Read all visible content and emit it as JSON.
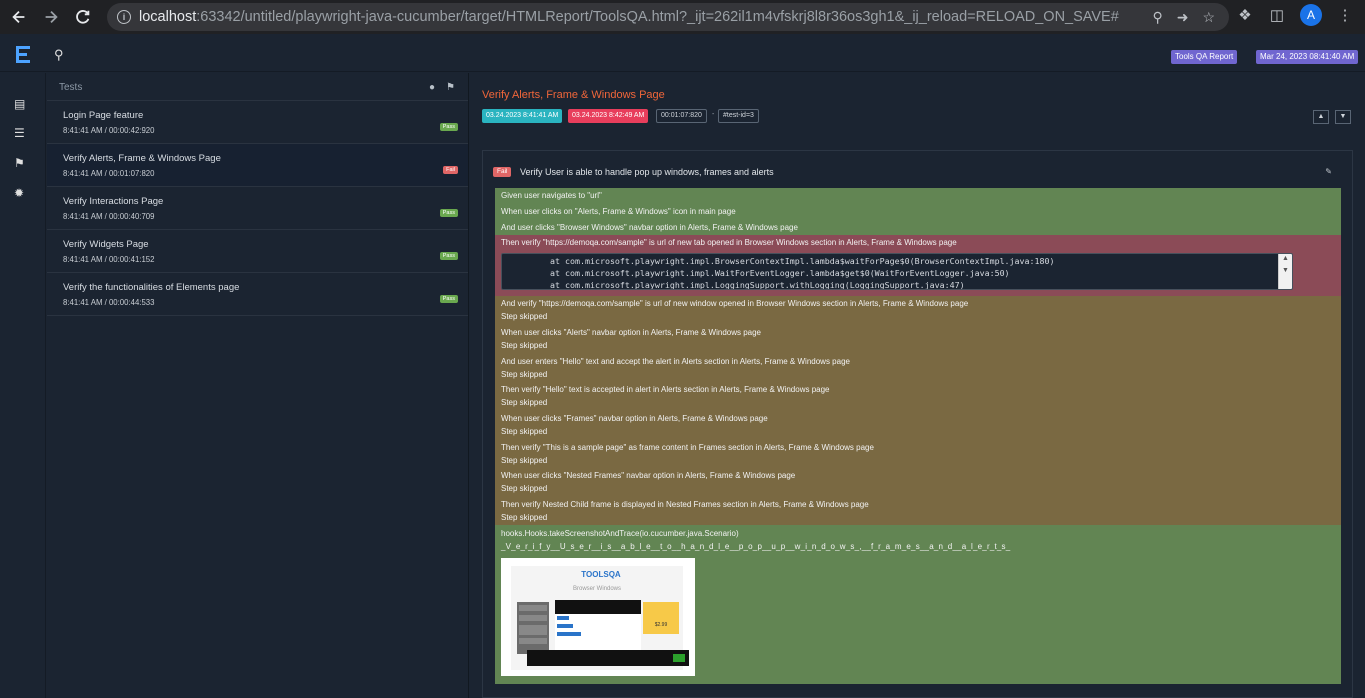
{
  "browser": {
    "url_host": "localhost",
    "url_rest": ":63342/untitled/playwright-java-cucumber/target/HTMLReport/ToolsQA.html?_ijt=262il1m4vfskrj8l8r36os3gh1&_ij_reload=RELOAD_ON_SAVE#",
    "profile_initial": "A"
  },
  "appbar": {
    "report_badge": "Tools QA Report",
    "date_badge": "Mar 24, 2023 08:41:40 AM"
  },
  "testlist": {
    "header": "Tests",
    "items": [
      {
        "name": "Login Page feature",
        "time": "8:41:41 AM / 00:00:42:920",
        "status": "Pass"
      },
      {
        "name": "Verify Alerts, Frame & Windows Page",
        "time": "8:41:41 AM / 00:01:07:820",
        "status": "Fail"
      },
      {
        "name": "Verify Interactions Page",
        "time": "8:41:41 AM / 00:00:40:709",
        "status": "Pass"
      },
      {
        "name": "Verify Widgets Page",
        "time": "8:41:41 AM / 00:00:41:152",
        "status": "Pass"
      },
      {
        "name": "Verify the functionalities of Elements page",
        "time": "8:41:41 AM / 00:00:44:533",
        "status": "Pass"
      }
    ]
  },
  "detail": {
    "title": "Verify Alerts, Frame & Windows Page",
    "start": "03.24.2023 8:41:41 AM",
    "end": "03.24.2023 8:42:49 AM",
    "duration": "00:01:07:820",
    "dash": "-",
    "test_id": "#test-id=3",
    "scenario_status": "Fail",
    "scenario_name": "Verify User is able to handle pop up windows, frames and alerts",
    "steps": [
      {
        "text": "Given user navigates to \"url\"",
        "state": "pass"
      },
      {
        "text": "When user clicks on \"Alerts, Frame & Windows\" icon in main page",
        "state": "pass"
      },
      {
        "text": "And user clicks \"Browser Windows\" navbar option in Alerts, Frame & Windows page",
        "state": "pass"
      },
      {
        "text": "Then verify \"https://demoqa.com/sample\" is url of new tab opened in Browser Windows section in Alerts, Frame & Windows page",
        "state": "fail"
      },
      {
        "text": "And verify \"https://demoqa.com/sample\" is url of new window opened in Browser Windows section in Alerts, Frame & Windows page",
        "state": "skip"
      },
      {
        "text": "When user clicks \"Alerts\" navbar option in Alerts, Frame & Windows page",
        "state": "skip"
      },
      {
        "text": "And user enters \"Hello\" text and accept the alert in Alerts section in Alerts, Frame & Windows page",
        "state": "skip"
      },
      {
        "text": "Then verify \"Hello\" text is accepted in alert in Alerts section in Alerts, Frame & Windows page",
        "state": "skip"
      },
      {
        "text": "When user clicks \"Frames\" navbar option in Alerts, Frame & Windows page",
        "state": "skip"
      },
      {
        "text": "Then verify \"This is a sample page\" as frame content in Frames section in Alerts, Frame & Windows page",
        "state": "skip"
      },
      {
        "text": "When user clicks \"Nested Frames\" navbar option in Alerts, Frame & Windows page",
        "state": "skip"
      },
      {
        "text": "Then verify Nested Child frame is displayed in Nested Frames section in Alerts, Frame & Windows page",
        "state": "skip"
      }
    ],
    "skipped_label": "Step skipped",
    "stacktrace": [
      "at com.microsoft.playwright.impl.BrowserContextImpl.lambda$waitForPage$0(BrowserContextImpl.java:180)",
      "at com.microsoft.playwright.impl.WaitForEventLogger.lambda$get$0(WaitForEventLogger.java:50)",
      "at com.microsoft.playwright.impl.LoggingSupport.withLogging(LoggingSupport.java:47)"
    ],
    "hook_name": "hooks.Hooks.takeScreenshotAndTrace(io.cucumber.java.Scenario)",
    "hook_file": "_V_e_r_i_f_y__U_s_e_r__i_s__a_b_l_e__t_o__h_a_n_d_l_e__p_o_p__u_p__w_i_n_d_o_w_s_,__f_r_a_m_e_s__a_n_d__a_l_e_r_t_s_",
    "screenshot": {
      "logo": "TOOLSQA",
      "page_title": "Browser Windows",
      "ad_price": "$2.99"
    }
  }
}
